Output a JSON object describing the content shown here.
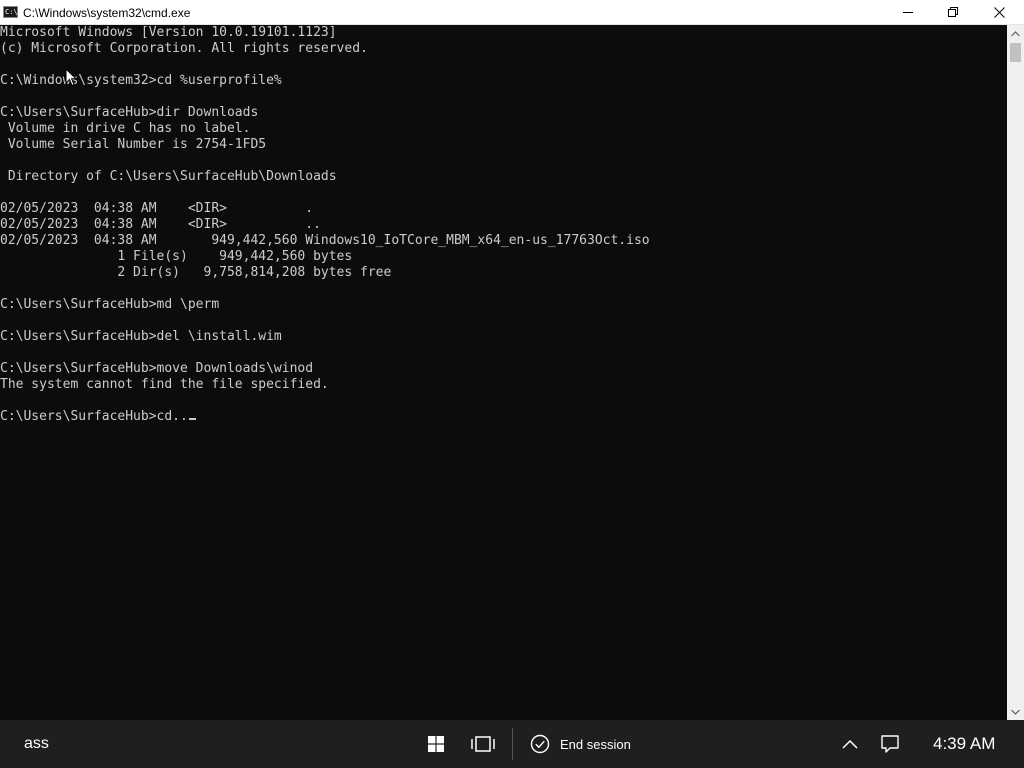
{
  "window": {
    "icon_text": "C:\\",
    "title": "C:\\Windows\\system32\\cmd.exe",
    "minimize_icon": "minimize-icon",
    "restore_icon": "restore-icon",
    "close_icon": "close-icon"
  },
  "console": {
    "lines": [
      "Microsoft Windows [Version 10.0.19101.1123]",
      "(c) Microsoft Corporation. All rights reserved.",
      "",
      "C:\\Windows\\system32>cd %userprofile%",
      "",
      "C:\\Users\\SurfaceHub>dir Downloads",
      " Volume in drive C has no label.",
      " Volume Serial Number is 2754-1FD5",
      "",
      " Directory of C:\\Users\\SurfaceHub\\Downloads",
      "",
      "02/05/2023  04:38 AM    <DIR>          .",
      "02/05/2023  04:38 AM    <DIR>          ..",
      "02/05/2023  04:38 AM       949,442,560 Windows10_IoTCore_MBM_x64_en-us_17763Oct.iso",
      "               1 File(s)    949,442,560 bytes",
      "               2 Dir(s)   9,758,814,208 bytes free",
      "",
      "C:\\Users\\SurfaceHub>md \\perm",
      "",
      "C:\\Users\\SurfaceHub>del \\install.wim",
      "",
      "C:\\Users\\SurfaceHub>move Downloads\\winod",
      "The system cannot find the file specified.",
      ""
    ],
    "current_input": "C:\\Users\\SurfaceHub>cd.."
  },
  "taskbar": {
    "left_text": "ass",
    "start_icon": "windows-start-icon",
    "task_view_icon": "task-view-icon",
    "end_session_icon": "check-circle-icon",
    "end_session_label": "End session",
    "tray_chevron_icon": "chevron-up-icon",
    "notifications_icon": "notification-icon",
    "clock": "4:39 AM"
  }
}
